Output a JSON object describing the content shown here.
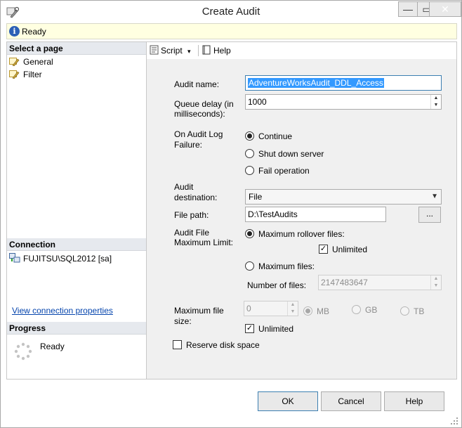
{
  "window": {
    "title": "Create Audit",
    "minimize": "—",
    "maximize": "▭",
    "close": "✕"
  },
  "status": {
    "text": "Ready"
  },
  "left": {
    "select_page_label": "Select a page",
    "pages": [
      "General",
      "Filter"
    ],
    "connection_label": "Connection",
    "connection_server": "FUJITSU\\SQL2012 [sa]",
    "view_connection_link": "View connection properties",
    "progress_label": "Progress",
    "progress_status": "Ready"
  },
  "toolbar": {
    "script_label": "Script",
    "script_arrow": "▾",
    "help_label": "Help"
  },
  "form": {
    "audit_name_label": "Audit name:",
    "audit_name_value": "AdventureWorksAudit_DDL_Access",
    "queue_delay_label_1": "Queue delay (in",
    "queue_delay_label_2": "milliseconds):",
    "queue_delay_value": "1000",
    "failure_label_1": "On Audit Log",
    "failure_label_2": "Failure:",
    "failure_continue": "Continue",
    "failure_shutdown": "Shut down server",
    "failure_fail": "Fail operation",
    "destination_label_1": "Audit",
    "destination_label_2": "destination:",
    "destination_value": "File",
    "file_path_label": "File path:",
    "file_path_value": "D:\\TestAudits",
    "browse_label": "...",
    "max_limit_label_1": "Audit File",
    "max_limit_label_2": "Maximum Limit:",
    "max_rollover_label": "Maximum rollover files:",
    "unlimited_label": "Unlimited",
    "max_files_label": "Maximum files:",
    "number_of_files_label": "Number of files:",
    "number_of_files_value": "2147483647",
    "max_file_size_label_1": "Maximum file",
    "max_file_size_label_2": "size:",
    "max_file_size_value": "0",
    "unit_mb": "MB",
    "unit_gb": "GB",
    "unit_tb": "TB",
    "size_unlimited_label": "Unlimited",
    "reserve_disk_label": "Reserve disk space"
  },
  "buttons": {
    "ok": "OK",
    "cancel": "Cancel",
    "help": "Help"
  },
  "colors": {
    "accent": "#3399ff",
    "close": "#c7302c",
    "status_bg": "#ffffe1",
    "link": "#0645ad"
  }
}
